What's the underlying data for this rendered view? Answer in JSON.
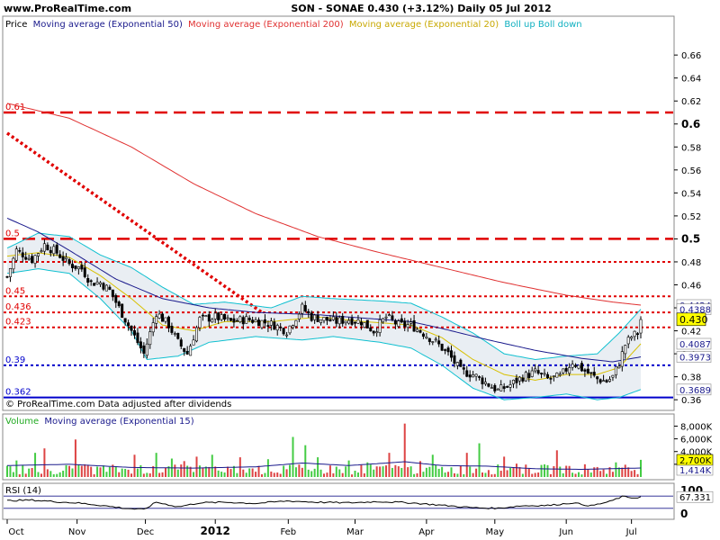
{
  "header": {
    "site": "www.ProRealTime.com",
    "title": "SON - SONAE   0.430 (+3.12%)   Daily  05 Jul 2012"
  },
  "footer": {
    "source_note": "© ProRealTime.com  Data adjusted after dividends"
  },
  "colors": {
    "background": "#ffffff",
    "plot_background": "#ffffff",
    "ema50": "#1a1a8c",
    "ema200": "#e03030",
    "ema20": "#d8c000",
    "bollinger": "#10c0d0",
    "bollinger_fill": "#e9eef3",
    "candle_up": "#ffffff",
    "candle_down": "#000000",
    "fib_red": "#e00000",
    "fib_blue": "#0000cc",
    "volume_up": "#44cc44",
    "volume_down": "#dd4444",
    "volume_ema": "#1a1a8c",
    "rsi_line": "#000000",
    "current_price_box": "#ffff00",
    "volume_box": "#ffff00"
  },
  "chart_data": [
    {
      "type": "candlestick",
      "legend": {
        "price": "Price",
        "ema50": "Moving average (Exponential 50)",
        "ema200": "Moving average (Exponential 200)",
        "ema20": "Moving average (Exponential 20)",
        "bollinger": "Boll up Boll down"
      },
      "ylim": [
        0.357,
        0.675
      ],
      "y_ticks": [
        "0.66",
        "0.64",
        "0.62",
        "0.6",
        "0.58",
        "0.56",
        "0.54",
        "0.52",
        "0.5",
        "0.48",
        "0.46",
        "0.44",
        "0.42",
        "0.4",
        "0.38",
        "0.36"
      ],
      "x_labels": [
        "Oct",
        "Nov",
        "Dec",
        "2012",
        "Feb",
        "Mar",
        "Apr",
        "May",
        "Jun",
        "Jul"
      ],
      "x_label_positions": [
        0.0,
        22.5,
        44.5,
        67,
        90.5,
        112,
        135,
        157,
        180,
        201
      ],
      "bars": 205,
      "levels": [
        {
          "label": "0.61",
          "value": 0.61,
          "style": "long-dash",
          "color": "red"
        },
        {
          "label": "0.5",
          "value": 0.5,
          "style": "long-dash",
          "color": "red"
        },
        {
          "label": "",
          "value": 0.48,
          "style": "dot",
          "color": "red"
        },
        {
          "label": "0.45",
          "value": 0.45,
          "style": "dot",
          "color": "red"
        },
        {
          "label": "0.436",
          "value": 0.436,
          "style": "dot",
          "color": "red"
        },
        {
          "label": "0.423",
          "value": 0.423,
          "style": "dot",
          "color": "red"
        },
        {
          "label": "0.39",
          "value": 0.39,
          "style": "dot",
          "color": "blue"
        },
        {
          "label": "0.362",
          "value": 0.362,
          "style": "solid",
          "color": "blue"
        }
      ],
      "trendline": {
        "start": [
          0,
          0.592
        ],
        "end": [
          82,
          0.436
        ]
      },
      "current_price": "0.430",
      "value_tags": [
        {
          "label": "0.4424",
          "value": 0.4424
        },
        {
          "label": "0.4388",
          "value": 0.4388
        },
        {
          "label": "0.4087",
          "value": 0.4087
        },
        {
          "label": "0.3973",
          "value": 0.3973
        },
        {
          "label": "0.3689",
          "value": 0.3689
        }
      ],
      "price_anchors": [
        [
          0,
          0.467
        ],
        [
          3,
          0.49
        ],
        [
          8,
          0.482
        ],
        [
          12,
          0.495
        ],
        [
          16,
          0.488
        ],
        [
          20,
          0.478
        ],
        [
          24,
          0.474
        ],
        [
          27,
          0.462
        ],
        [
          30,
          0.462
        ],
        [
          33,
          0.455
        ],
        [
          36,
          0.44
        ],
        [
          40,
          0.42
        ],
        [
          44,
          0.4
        ],
        [
          48,
          0.436
        ],
        [
          52,
          0.425
        ],
        [
          55,
          0.41
        ],
        [
          58,
          0.4
        ],
        [
          62,
          0.43
        ],
        [
          67,
          0.432
        ],
        [
          72,
          0.428
        ],
        [
          77,
          0.43
        ],
        [
          82,
          0.428
        ],
        [
          86,
          0.425
        ],
        [
          90,
          0.42
        ],
        [
          95,
          0.44
        ],
        [
          98,
          0.432
        ],
        [
          102,
          0.43
        ],
        [
          106,
          0.428
        ],
        [
          110,
          0.43
        ],
        [
          114,
          0.428
        ],
        [
          118,
          0.42
        ],
        [
          122,
          0.432
        ],
        [
          126,
          0.425
        ],
        [
          130,
          0.425
        ],
        [
          134,
          0.418
        ],
        [
          138,
          0.41
        ],
        [
          142,
          0.4
        ],
        [
          146,
          0.385
        ],
        [
          150,
          0.382
        ],
        [
          154,
          0.375
        ],
        [
          158,
          0.368
        ],
        [
          162,
          0.373
        ],
        [
          166,
          0.38
        ],
        [
          170,
          0.384
        ],
        [
          174,
          0.378
        ],
        [
          178,
          0.38
        ],
        [
          182,
          0.393
        ],
        [
          186,
          0.385
        ],
        [
          190,
          0.378
        ],
        [
          193,
          0.376
        ],
        [
          195,
          0.38
        ],
        [
          197,
          0.392
        ],
        [
          199,
          0.408
        ],
        [
          201,
          0.415
        ],
        [
          203,
          0.418
        ],
        [
          204,
          0.43
        ]
      ],
      "ema50_anchors": [
        [
          0,
          0.518
        ],
        [
          10,
          0.506
        ],
        [
          20,
          0.49
        ],
        [
          35,
          0.465
        ],
        [
          50,
          0.448
        ],
        [
          65,
          0.44
        ],
        [
          80,
          0.436
        ],
        [
          100,
          0.434
        ],
        [
          115,
          0.431
        ],
        [
          130,
          0.428
        ],
        [
          140,
          0.422
        ],
        [
          155,
          0.412
        ],
        [
          170,
          0.403
        ],
        [
          185,
          0.396
        ],
        [
          195,
          0.393
        ],
        [
          204,
          0.3973
        ]
      ],
      "ema200_anchors": [
        [
          0,
          0.618
        ],
        [
          20,
          0.605
        ],
        [
          40,
          0.58
        ],
        [
          60,
          0.548
        ],
        [
          80,
          0.522
        ],
        [
          100,
          0.502
        ],
        [
          120,
          0.488
        ],
        [
          140,
          0.475
        ],
        [
          160,
          0.462
        ],
        [
          180,
          0.451
        ],
        [
          195,
          0.445
        ],
        [
          204,
          0.4424
        ]
      ],
      "ema20_anchors": [
        [
          0,
          0.485
        ],
        [
          10,
          0.488
        ],
        [
          20,
          0.484
        ],
        [
          30,
          0.468
        ],
        [
          40,
          0.448
        ],
        [
          50,
          0.425
        ],
        [
          60,
          0.42
        ],
        [
          70,
          0.428
        ],
        [
          85,
          0.428
        ],
        [
          100,
          0.432
        ],
        [
          115,
          0.428
        ],
        [
          130,
          0.425
        ],
        [
          140,
          0.414
        ],
        [
          150,
          0.395
        ],
        [
          160,
          0.382
        ],
        [
          170,
          0.377
        ],
        [
          180,
          0.382
        ],
        [
          190,
          0.382
        ],
        [
          197,
          0.388
        ],
        [
          204,
          0.4087
        ]
      ],
      "boll_up_anchors": [
        [
          0,
          0.492
        ],
        [
          10,
          0.505
        ],
        [
          20,
          0.502
        ],
        [
          30,
          0.486
        ],
        [
          40,
          0.475
        ],
        [
          50,
          0.458
        ],
        [
          60,
          0.443
        ],
        [
          70,
          0.445
        ],
        [
          85,
          0.44
        ],
        [
          95,
          0.45
        ],
        [
          105,
          0.448
        ],
        [
          120,
          0.446
        ],
        [
          130,
          0.444
        ],
        [
          140,
          0.432
        ],
        [
          150,
          0.418
        ],
        [
          160,
          0.4
        ],
        [
          170,
          0.395
        ],
        [
          180,
          0.398
        ],
        [
          190,
          0.4
        ],
        [
          197,
          0.418
        ],
        [
          204,
          0.4388
        ]
      ],
      "boll_down_anchors": [
        [
          0,
          0.47
        ],
        [
          10,
          0.474
        ],
        [
          20,
          0.47
        ],
        [
          30,
          0.448
        ],
        [
          40,
          0.42
        ],
        [
          45,
          0.395
        ],
        [
          55,
          0.398
        ],
        [
          65,
          0.41
        ],
        [
          80,
          0.415
        ],
        [
          95,
          0.412
        ],
        [
          105,
          0.415
        ],
        [
          120,
          0.41
        ],
        [
          130,
          0.405
        ],
        [
          140,
          0.39
        ],
        [
          150,
          0.37
        ],
        [
          160,
          0.36
        ],
        [
          170,
          0.362
        ],
        [
          180,
          0.365
        ],
        [
          190,
          0.36
        ],
        [
          197,
          0.362
        ],
        [
          204,
          0.3689
        ]
      ]
    },
    {
      "type": "bar",
      "legend": {
        "volume": "Volume",
        "ema15": "Moving average (Exponential 15)"
      },
      "ylim": [
        0,
        9200000
      ],
      "y_ticks": [
        "8,000K",
        "6,000K",
        "4,000K",
        "2,000K"
      ],
      "current_volume": "2,700K",
      "volume_ema_value": "1,414K",
      "spikes": [
        [
          3,
          2600000
        ],
        [
          9,
          3800000
        ],
        [
          12,
          4500000
        ],
        [
          22,
          5900000
        ],
        [
          25,
          2000000
        ],
        [
          41,
          3500000
        ],
        [
          48,
          3800000
        ],
        [
          53,
          2900000
        ],
        [
          57,
          2500000
        ],
        [
          61,
          3200000
        ],
        [
          66,
          3500000
        ],
        [
          75,
          3100000
        ],
        [
          84,
          2800000
        ],
        [
          92,
          6300000
        ],
        [
          96,
          5000000
        ],
        [
          100,
          3100000
        ],
        [
          110,
          2600000
        ],
        [
          116,
          2300000
        ],
        [
          123,
          3800000
        ],
        [
          128,
          8400000
        ],
        [
          133,
          2500000
        ],
        [
          137,
          3500000
        ],
        [
          148,
          3800000
        ],
        [
          152,
          5300000
        ],
        [
          160,
          3200000
        ],
        [
          164,
          2100000
        ],
        [
          177,
          4200000
        ],
        [
          186,
          2000000
        ],
        [
          196,
          2300000
        ],
        [
          204,
          2700000
        ]
      ],
      "ema_anchors": [
        [
          0,
          1800000
        ],
        [
          20,
          2000000
        ],
        [
          40,
          1500000
        ],
        [
          60,
          1400000
        ],
        [
          80,
          1600000
        ],
        [
          95,
          2200000
        ],
        [
          110,
          1800000
        ],
        [
          128,
          2400000
        ],
        [
          140,
          1800000
        ],
        [
          155,
          1700000
        ],
        [
          170,
          1300000
        ],
        [
          185,
          1200000
        ],
        [
          204,
          1414000
        ]
      ]
    },
    {
      "type": "line",
      "legend": {
        "rsi": "RSI (14)"
      },
      "ylim": [
        0,
        100
      ],
      "y_ticks": [
        "100",
        "0"
      ],
      "current_value": "67.331",
      "anchors": [
        [
          0,
          55
        ],
        [
          8,
          57
        ],
        [
          15,
          52
        ],
        [
          22,
          48
        ],
        [
          30,
          40
        ],
        [
          38,
          30
        ],
        [
          44,
          26
        ],
        [
          48,
          50
        ],
        [
          55,
          35
        ],
        [
          62,
          48
        ],
        [
          70,
          50
        ],
        [
          80,
          46
        ],
        [
          90,
          54
        ],
        [
          100,
          50
        ],
        [
          110,
          48
        ],
        [
          120,
          52
        ],
        [
          130,
          48
        ],
        [
          140,
          40
        ],
        [
          150,
          32
        ],
        [
          158,
          30
        ],
        [
          165,
          38
        ],
        [
          175,
          40
        ],
        [
          182,
          48
        ],
        [
          188,
          38
        ],
        [
          194,
          52
        ],
        [
          198,
          68
        ],
        [
          202,
          64
        ],
        [
          204,
          67.3
        ]
      ]
    }
  ]
}
